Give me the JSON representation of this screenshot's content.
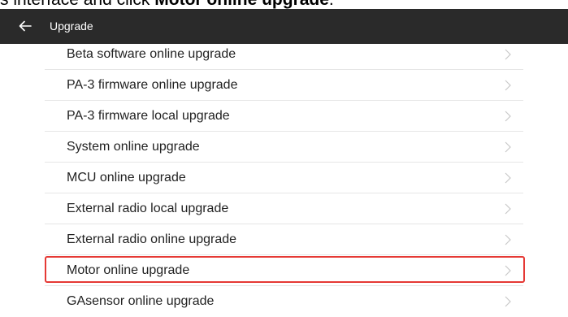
{
  "caption": {
    "prefix": "s interface and click ",
    "bold": "Motor online upgrade",
    "suffix": "."
  },
  "topbar": {
    "title": "Upgrade",
    "back_icon": "arrow-left-icon"
  },
  "list": {
    "items": [
      {
        "label": "Beta software online upgrade"
      },
      {
        "label": "PA-3 firmware online upgrade"
      },
      {
        "label": "PA-3 firmware local upgrade"
      },
      {
        "label": "System online upgrade"
      },
      {
        "label": "MCU online upgrade"
      },
      {
        "label": "External radio local upgrade"
      },
      {
        "label": "External radio online upgrade"
      },
      {
        "label": "Motor online upgrade"
      },
      {
        "label": "GAsensor online upgrade"
      }
    ],
    "chevron_icon": "chevron-right-icon",
    "highlighted_item": "Motor online upgrade"
  },
  "colors": {
    "topbar_bg": "#2a2a2a",
    "highlight_border": "#e53935",
    "chevron": "#c8c8c8"
  }
}
